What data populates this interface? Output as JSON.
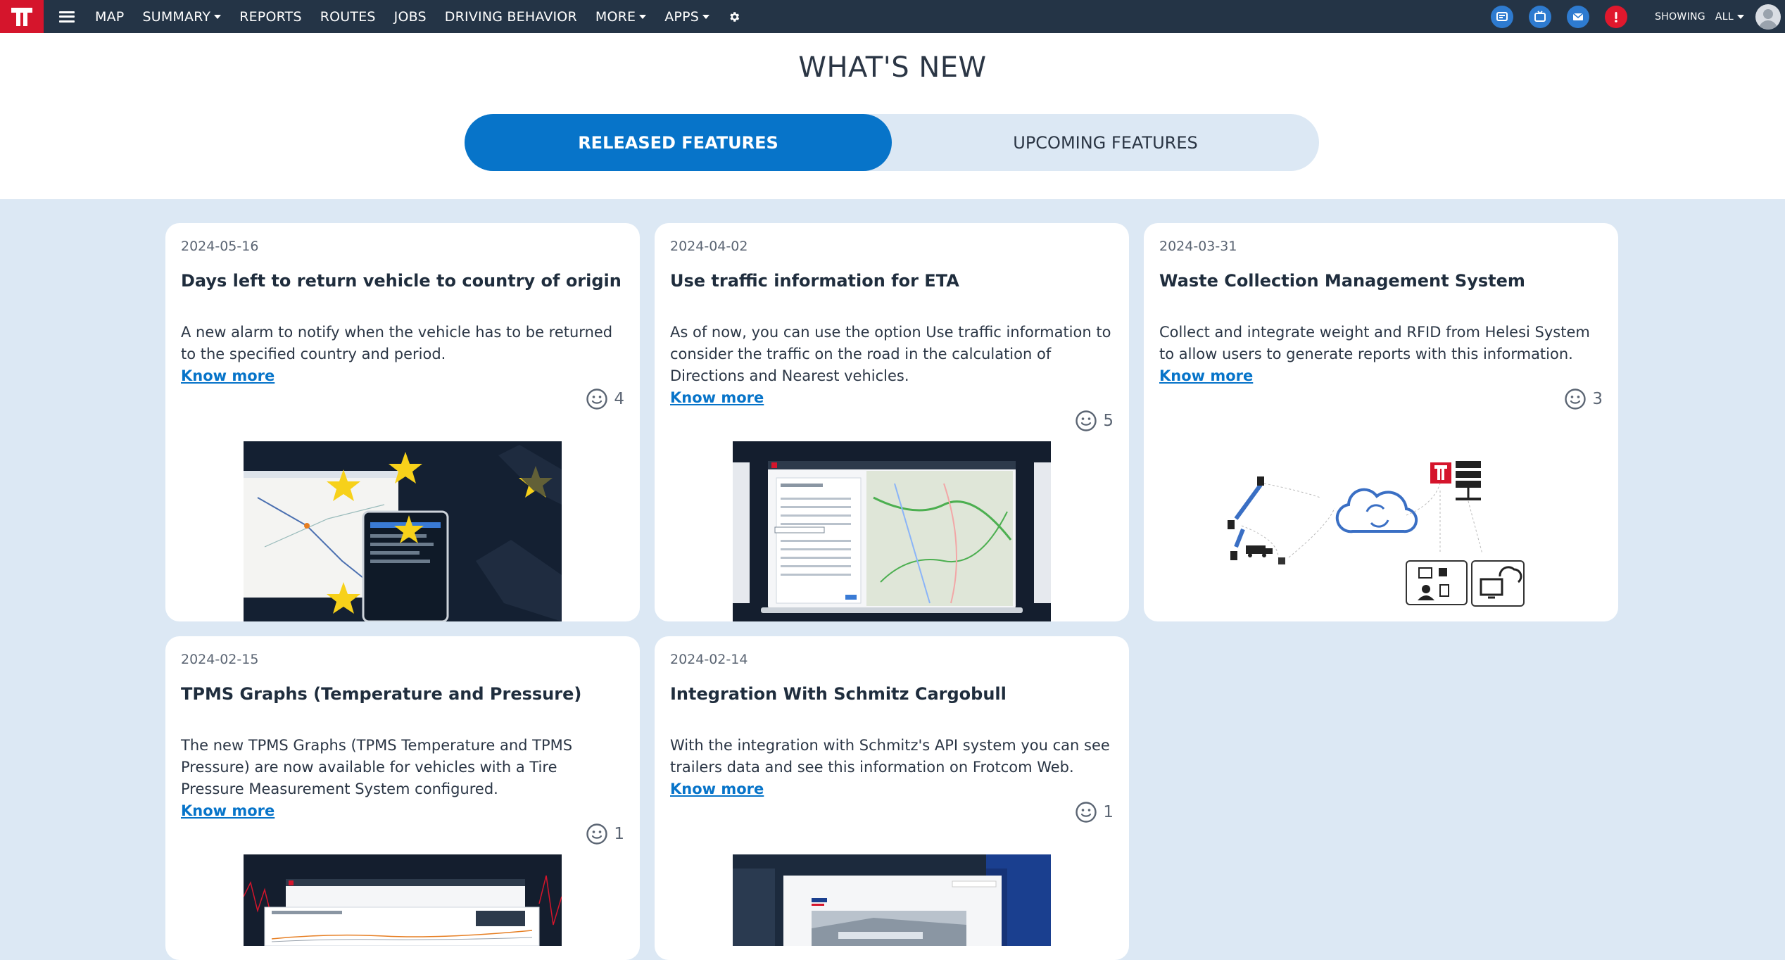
{
  "nav": {
    "items": [
      {
        "label": "MAP",
        "caret": false
      },
      {
        "label": "SUMMARY",
        "caret": true
      },
      {
        "label": "REPORTS",
        "caret": false
      },
      {
        "label": "ROUTES",
        "caret": false
      },
      {
        "label": "JOBS",
        "caret": false
      },
      {
        "label": "DRIVING BEHAVIOR",
        "caret": false
      },
      {
        "label": "MORE",
        "caret": true
      },
      {
        "label": "APPS",
        "caret": true
      }
    ],
    "showing_label": "SHOWING",
    "showing_value": "ALL"
  },
  "page": {
    "title": "WHAT'S NEW",
    "tab_released": "RELEASED FEATURES",
    "tab_upcoming": "UPCOMING FEATURES"
  },
  "cards": [
    {
      "date": "2024-05-16",
      "title": "Days left to return vehicle to country of origin",
      "description": "A new alarm to notify when the vehicle has to be returned to the specified country and period.",
      "link": "Know more",
      "likes": "4"
    },
    {
      "date": "2024-04-02",
      "title": "Use traffic information for ETA",
      "description": "As of now, you can use the option Use traffic information to consider the traffic on the road in the calculation of Directions and Nearest vehicles.",
      "link": "Know more",
      "likes": "5"
    },
    {
      "date": "2024-03-31",
      "title": "Waste Collection Management System",
      "description": "Collect and integrate weight and RFID from Helesi System to allow users to generate reports with this information.",
      "link": "Know more",
      "likes": "3"
    },
    {
      "date": "2024-02-15",
      "title": "TPMS Graphs (Temperature and Pressure)",
      "description": "The new TPMS Graphs (TPMS Temperature and TPMS Pressure) are now available for vehicles with a Tire Pressure Measurement System configured.",
      "link": "Know more",
      "likes": "1"
    },
    {
      "date": "2024-02-14",
      "title": "Integration With Schmitz Cargobull",
      "description": "With the integration with Schmitz's API system you can see trailers data and see this information on Frotcom Web.",
      "link": "Know more",
      "likes": "1"
    }
  ],
  "colors": {
    "topbar": "#243446",
    "logo": "#d5152c",
    "accent": "#0774c9",
    "background": "#dce8f4",
    "alert": "#e0182d"
  },
  "icons": {
    "logo": "frotcom-logo-icon",
    "menu": "hamburger-menu-icon",
    "settings": "gear-icon",
    "translate": "translate-icon",
    "tv": "tv-icon",
    "mail": "mail-icon",
    "alert": "alert-icon",
    "like": "smiley-icon"
  }
}
